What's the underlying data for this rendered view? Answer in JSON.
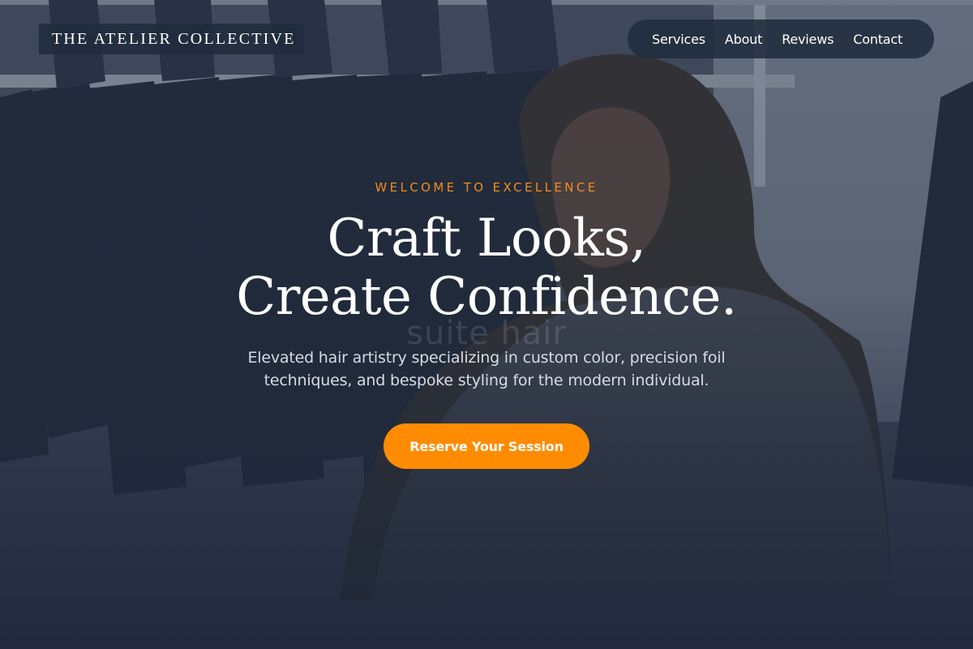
{
  "header": {
    "logo_text": "THE ATELIER COLLECTIVE",
    "nav": {
      "services": "Services",
      "about": "About",
      "reviews": "Reviews",
      "contact": "Contact"
    }
  },
  "hero": {
    "eyebrow": "WELCOME TO EXCELLENCE",
    "headline_line1": "Craft Looks,",
    "headline_line2": "Create Confidence.",
    "background_text": "suite hair",
    "subtitle": "Elevated hair artistry specializing in custom color, precision foil techniques, and bespoke styling for the modern individual.",
    "cta_label": "Reserve Your Session"
  },
  "colors": {
    "accent": "#ff8c00",
    "eyebrow": "#f28c1e",
    "overlay": "#1e2a3c",
    "text": "#ffffff"
  }
}
